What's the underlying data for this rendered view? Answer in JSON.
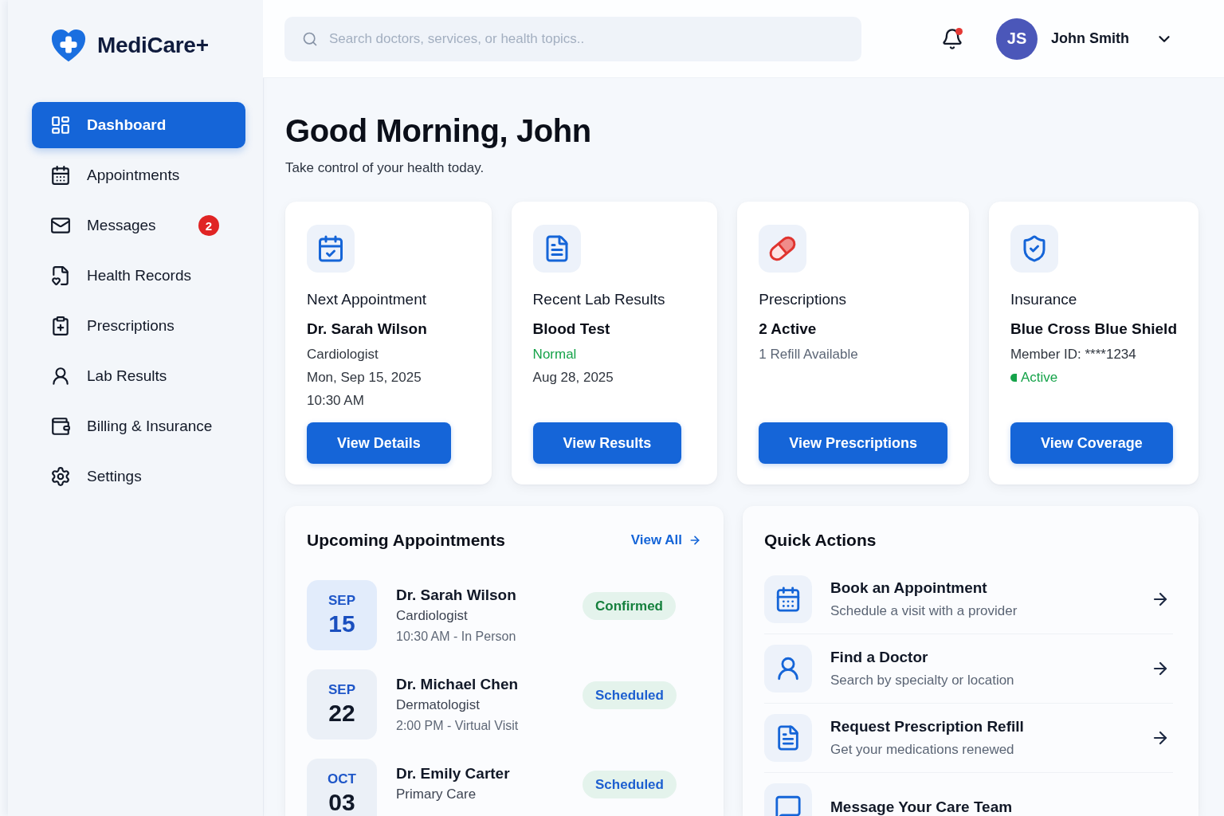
{
  "sidebar": {
    "brand": "MediCare+",
    "items": [
      {
        "label": "Dashboard",
        "selected": true
      },
      {
        "label": "Appointments",
        "selected": false
      },
      {
        "label": "Messages",
        "selected": false,
        "badge": "2"
      },
      {
        "label": "Health Records",
        "selected": false
      },
      {
        "label": "Prescriptions",
        "selected": false
      },
      {
        "label": "Lab Results",
        "selected": false
      },
      {
        "label": "Billing & Insurance",
        "selected": false
      },
      {
        "label": "Settings",
        "selected": false
      }
    ]
  },
  "header": {
    "search": {
      "placeholder": "Search doctors, services, or health topics.."
    },
    "notifications": {
      "unread": true
    },
    "user": {
      "initials": "JS",
      "name": "John Smith"
    }
  },
  "greeting": {
    "title": "Good Morning, John",
    "subtitle": "Take control of your health today."
  },
  "summary_cards": [
    {
      "title": "Next Appointment",
      "headline": "Dr. Sarah Wilson",
      "lines": [
        {
          "kind": "detail",
          "text": "Cardiologist"
        },
        {
          "kind": "detail",
          "text": "Mon, Sep 15, 2025"
        },
        {
          "kind": "detail",
          "text": "10:30 AM"
        }
      ],
      "button": "View Details"
    },
    {
      "title": "Recent Lab Results",
      "headline": "Blood Test",
      "lines": [
        {
          "kind": "status",
          "text": "Normal"
        },
        {
          "kind": "detail",
          "text": "Aug 28, 2025"
        }
      ],
      "button": "View Results"
    },
    {
      "title": "Prescriptions",
      "headline": "2 Active",
      "lines": [
        {
          "kind": "muted",
          "text": "1 Refill Available"
        }
      ],
      "button": "View Prescriptions"
    },
    {
      "title": "Insurance",
      "headline": "Blue Cross Blue Shield",
      "lines": [
        {
          "kind": "detail",
          "text": "Member ID: ****1234"
        },
        {
          "kind": "status",
          "text": "Active",
          "dot": true
        }
      ],
      "button": "View Coverage"
    }
  ],
  "upcoming_appointments": {
    "title": "Upcoming Appointments",
    "view_all": "View All",
    "items": [
      {
        "month": "SEP",
        "day": "15",
        "doctor": "Dr. Sarah Wilson",
        "specialty": "Cardiologist",
        "time": "10:30 AM - In Person",
        "status": {
          "text": "Confirmed",
          "color": "#15803d"
        },
        "selected": true
      },
      {
        "month": "SEP",
        "day": "22",
        "doctor": "Dr. Michael Chen",
        "specialty": "Dermatologist",
        "time": "2:00 PM - Virtual Visit",
        "status": {
          "text": "Scheduled",
          "color": "#1d5fd0"
        },
        "selected": false
      },
      {
        "month": "OCT",
        "day": "03",
        "doctor": "Dr. Emily Carter",
        "specialty": "Primary Care",
        "status": {
          "text": "Scheduled",
          "color": "#1d5fd0"
        },
        "selected": false
      }
    ]
  },
  "quick_actions": {
    "title": "Quick Actions",
    "items": [
      {
        "title": "Book an Appointment",
        "subtitle": "Schedule a visit with a provider"
      },
      {
        "title": "Find a Doctor",
        "subtitle": "Search by specialty or location"
      },
      {
        "title": "Request Prescription Refill",
        "subtitle": "Get your medications renewed"
      },
      {
        "title": "Message Your Care Team"
      }
    ]
  }
}
